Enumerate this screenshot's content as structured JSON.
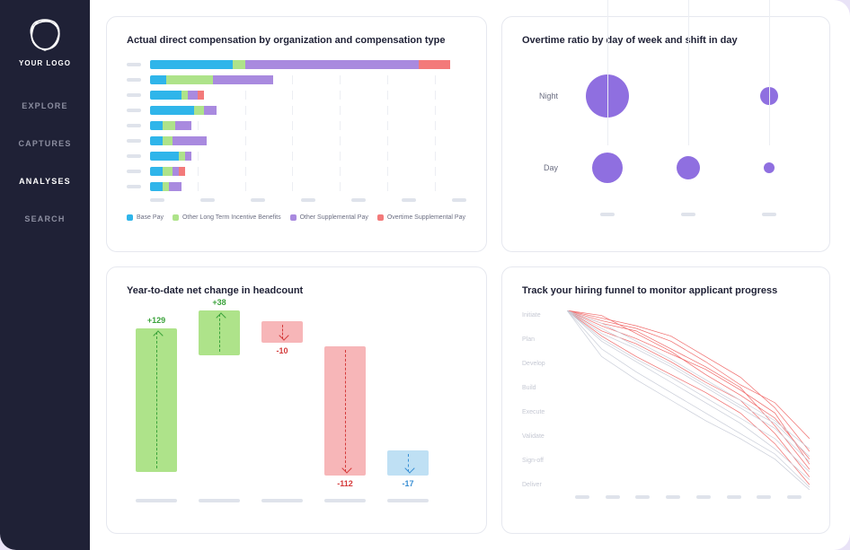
{
  "brand": {
    "logo_label": "YOUR LOGO"
  },
  "nav": [
    {
      "label": "EXPLORE",
      "active": false
    },
    {
      "label": "CAPTURES",
      "active": false
    },
    {
      "label": "ANALYSES",
      "active": true
    },
    {
      "label": "SEARCH",
      "active": false
    }
  ],
  "colors": {
    "base_pay": "#2fb5ea",
    "lti": "#aee38a",
    "supplemental": "#a98adf",
    "overtime_supp": "#f37a7a",
    "bubble": "#8f6fe0",
    "pos": "#aee38a",
    "pos_text": "#3aa23a",
    "neg": "#f7b6b8",
    "neg_text": "#d43a3a",
    "neg_blue": "#bfe0f4",
    "neg_blue_text": "#3a8fd4",
    "grid": "#eceef3",
    "line_red": "#f06a6a",
    "line_grey": "#c9cdd8"
  },
  "cards": {
    "comp": {
      "title": "Actual direct compensation by organization and compensation type",
      "legend": [
        {
          "label": "Base Pay",
          "color": "base_pay"
        },
        {
          "label": "Other Long Term Incentive Benefits",
          "color": "lti"
        },
        {
          "label": "Other Supplemental Pay",
          "color": "supplemental"
        },
        {
          "label": "Overtime Supplemental Pay",
          "color": "overtime_supp"
        }
      ]
    },
    "overtime": {
      "title": "Overtime ratio by day of week and shift in day",
      "rows": [
        "Night",
        "Day"
      ]
    },
    "headcount": {
      "title": "Year-to-date net change in headcount"
    },
    "funnel": {
      "title": "Track your hiring funnel to monitor applicant progress",
      "stages": [
        "Initiate",
        "Plan",
        "Develop",
        "Build",
        "Execute",
        "Validate",
        "Sign-off",
        "Deliver"
      ]
    }
  },
  "chart_data": [
    {
      "type": "bar",
      "id": "comp",
      "title": "Actual direct compensation by organization and compensation type",
      "x_max": 100,
      "gridlines": [
        15,
        30,
        45,
        60,
        75,
        90
      ],
      "series_names": [
        "Base Pay",
        "Other Long Term Incentive Benefits",
        "Other Supplemental Pay",
        "Overtime Supplemental Pay"
      ],
      "rows": [
        {
          "values": [
            26,
            4,
            55,
            10
          ]
        },
        {
          "values": [
            5,
            15,
            19,
            0
          ]
        },
        {
          "values": [
            10,
            2,
            3,
            2
          ]
        },
        {
          "values": [
            14,
            3,
            4,
            0
          ]
        },
        {
          "values": [
            4,
            4,
            5,
            0
          ]
        },
        {
          "values": [
            4,
            3,
            11,
            0
          ]
        },
        {
          "values": [
            9,
            2,
            2,
            0
          ]
        },
        {
          "values": [
            4,
            3,
            2,
            2
          ]
        },
        {
          "values": [
            4,
            2,
            4,
            0
          ]
        }
      ]
    },
    {
      "type": "scatter",
      "id": "overtime",
      "title": "Overtime ratio by day of week and shift in day",
      "y_categories": [
        "Night",
        "Day"
      ],
      "x_columns": 3,
      "points": [
        {
          "row": "Night",
          "col": 0,
          "size": 48
        },
        {
          "row": "Night",
          "col": 2,
          "size": 20
        },
        {
          "row": "Day",
          "col": 0,
          "size": 34
        },
        {
          "row": "Day",
          "col": 1,
          "size": 26
        },
        {
          "row": "Day",
          "col": 2,
          "size": 12
        }
      ]
    },
    {
      "type": "bar",
      "id": "headcount",
      "title": "Year-to-date net change in headcount",
      "subtype": "waterfall",
      "bars": [
        {
          "value": 129,
          "label": "+129",
          "dir": "up",
          "color": "pos",
          "top": 0.1,
          "height": 0.8
        },
        {
          "value": 38,
          "label": "+38",
          "dir": "up",
          "color": "pos",
          "top": 0.0,
          "height": 0.25
        },
        {
          "value": -10,
          "label": "-10",
          "dir": "dn",
          "color": "neg",
          "top": 0.06,
          "height": 0.12
        },
        {
          "value": -112,
          "label": "-112",
          "dir": "dn",
          "color": "neg",
          "top": 0.2,
          "height": 0.72
        },
        {
          "value": -17,
          "label": "-17",
          "dir": "dn",
          "color": "neg_blue",
          "top": 0.78,
          "height": 0.14
        }
      ]
    },
    {
      "type": "line",
      "id": "funnel",
      "title": "Track your hiring funnel to monitor applicant progress",
      "y_categories": [
        "Initiate",
        "Plan",
        "Develop",
        "Build",
        "Execute",
        "Validate",
        "Sign-off",
        "Deliver"
      ],
      "x_columns": 8,
      "series": [
        {
          "color": "line_red",
          "y": [
            0,
            0.5,
            0.8,
            1.5,
            2.2,
            3.0,
            4.5,
            6.2
          ]
        },
        {
          "color": "line_red",
          "y": [
            0,
            0.3,
            0.6,
            1.0,
            1.8,
            2.6,
            3.8,
            5.5
          ]
        },
        {
          "color": "line_red",
          "y": [
            0,
            0.8,
            1.3,
            2.0,
            2.8,
            3.5,
            4.8,
            6.5
          ]
        },
        {
          "color": "line_red",
          "y": [
            0,
            0.2,
            0.9,
            1.6,
            2.5,
            3.3,
            4.2,
            5.8
          ]
        },
        {
          "color": "line_red",
          "y": [
            0,
            0.6,
            1.1,
            1.7,
            2.3,
            3.1,
            4.0,
            6.0
          ]
        },
        {
          "color": "line_red",
          "y": [
            0,
            1.0,
            1.8,
            2.5,
            3.2,
            4.0,
            5.2,
            6.8
          ]
        },
        {
          "color": "line_red",
          "y": [
            0,
            0.4,
            0.7,
            1.2,
            2.0,
            2.9,
            3.6,
            5.0
          ]
        },
        {
          "color": "line_grey",
          "y": [
            0,
            1.2,
            2.0,
            2.8,
            3.6,
            4.4,
            5.4,
            6.6
          ]
        },
        {
          "color": "line_grey",
          "y": [
            0,
            0.9,
            1.5,
            2.2,
            3.0,
            3.8,
            4.6,
            5.9
          ]
        },
        {
          "color": "line_grey",
          "y": [
            0,
            1.5,
            2.4,
            3.2,
            4.0,
            4.8,
            5.6,
            6.9
          ]
        },
        {
          "color": "line_grey",
          "y": [
            0,
            0.7,
            1.4,
            2.1,
            2.9,
            3.7,
            4.4,
            5.7
          ]
        },
        {
          "color": "line_grey",
          "y": [
            0,
            1.8,
            2.7,
            3.5,
            4.3,
            5.0,
            5.8,
            7.0
          ]
        },
        {
          "color": "line_grey",
          "y": [
            0,
            1.1,
            1.9,
            2.6,
            3.4,
            4.2,
            5.0,
            6.3
          ]
        },
        {
          "color": "line_grey",
          "y": [
            0,
            0.5,
            1.2,
            1.9,
            2.7,
            3.5,
            4.3,
            5.4
          ]
        }
      ]
    }
  ]
}
